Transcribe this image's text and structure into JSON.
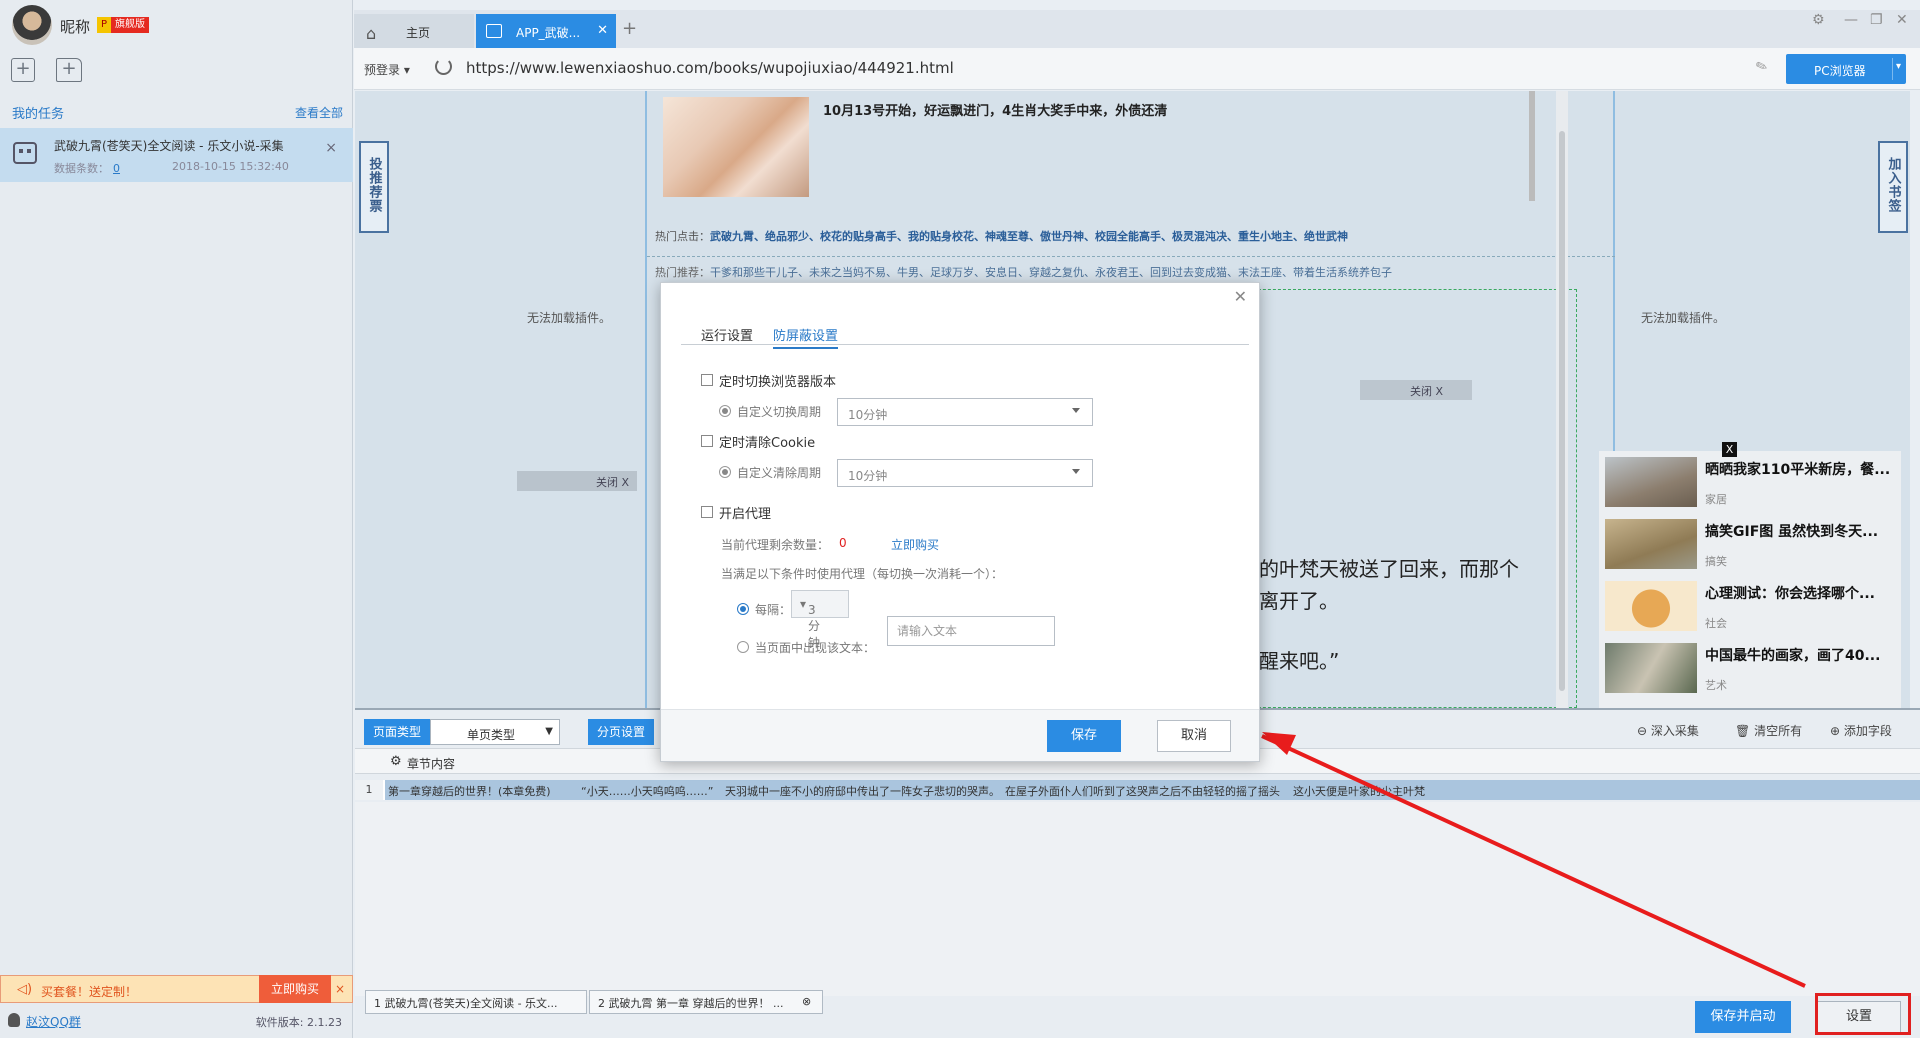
{
  "user": {
    "nickname": "昵称",
    "badge_p": "P",
    "badge_vip": "旗舰版"
  },
  "sidebar": {
    "my_tasks": "我的任务",
    "view_all": "查看全部",
    "task": {
      "title": "武破九霄(苍笑天)全文阅读 - 乐文小说-采集",
      "data_count_label": "数据条数：",
      "data_count": "0",
      "time": "2018-10-15 15:32:40"
    },
    "promo": {
      "text": "买套餐！送定制！",
      "buy": "立即购买",
      "close": "×"
    },
    "qq_group": "赵汶QQ群",
    "version": "软件版本: 2.1.23"
  },
  "tabs": {
    "home": "主页",
    "app": "APP_武破..."
  },
  "address": {
    "pre_login": "预登录",
    "url": "https://www.lewenxiaoshuo.com/books/wupojiuxiao/444921.html",
    "browser_mode": "PC浏览器"
  },
  "webpage": {
    "news_title": "10月13号开始，好运飘进门，4生肖大奖手中来，外债还清",
    "hot_clicks_label": "热门点击：",
    "hot_clicks": "武破九霄、绝品邪少、校花的贴身高手、我的贴身校花、神魂至尊、傲世丹神、校园全能高手、极灵混沌决、重生小地主、绝世武神",
    "hot_rec_label": "热门推荐：",
    "hot_rec": "干爹和那些干儿子、未来之当妈不易、牛男、足球万岁、安息日、穿越之复仇、永夜君王、回到过去变成猫、末法王座、带着生活系统养包子",
    "recommend_side": "投推荐票",
    "bookmark_side": "加入书签",
    "plugin_left": "无法加载插件。",
    "plugin_right": "无法加载插件。",
    "close_left": "关闭 X",
    "close_right": "关闭 X",
    "story_line1": "的叶梵天被送了回来，而那个",
    "story_line2": "离开了。",
    "story_line3": "醒来吧。”",
    "ads": [
      {
        "title": "晒晒我家110平米新房，餐...",
        "cat": "家居"
      },
      {
        "title": "搞笑GIF图 虽然快到冬天...",
        "cat": "搞笑"
      },
      {
        "title": "心理测试：你会选择哪个...",
        "cat": "社会"
      },
      {
        "title": "中国最牛的画家，画了40...",
        "cat": "艺术"
      }
    ],
    "ad_close": "X"
  },
  "bottom": {
    "page_type_label": "页面类型",
    "page_type_value": "单页类型",
    "paging": "分页设置",
    "deep_collect": "深入采集",
    "clear_all": "清空所有",
    "add_field": "添加字段",
    "column": "章节内容",
    "row_num": "1",
    "cells": [
      "第一章穿越后的世界！(本章免费)",
      "“小天……小天呜呜呜……”",
      "天羽城中一座不小的府邸中传出了一阵女子悲切的哭声。",
      "在屋子外面仆人们听到了这哭声之后不由轻轻的摇了摇头",
      "这小天便是叶家的少主叶梵"
    ],
    "tab1": "1 武破九霄(苍笑天)全文阅读 - 乐文...",
    "tab2": "2 武破九霄 第一章 穿越后的世界！ ...",
    "save_start": "保存并启动",
    "settings": "设置"
  },
  "modal": {
    "tab_run": "运行设置",
    "tab_anti": "防屏蔽设置",
    "switch_browser": "定时切换浏览器版本",
    "custom_switch": "自定义切换周期",
    "switch_period": "10分钟",
    "clear_cookie": "定时清除Cookie",
    "custom_clear": "自定义清除周期",
    "clear_period": "10分钟",
    "enable_proxy": "开启代理",
    "remaining_label": "当前代理剩余数量：",
    "remaining": "0",
    "buy_now": "立即购买",
    "condition": "当满足以下条件时使用代理（每切换一次消耗一个）：",
    "every": "每隔：",
    "every_value": "3分钟",
    "when_text": "当页面中出现该文本：",
    "text_placeholder": "请输入文本",
    "save": "保存",
    "cancel": "取消"
  },
  "colors": {
    "accent": "#2b8ce3",
    "highlight": "#e02020",
    "selected_row": "#aac5de"
  }
}
